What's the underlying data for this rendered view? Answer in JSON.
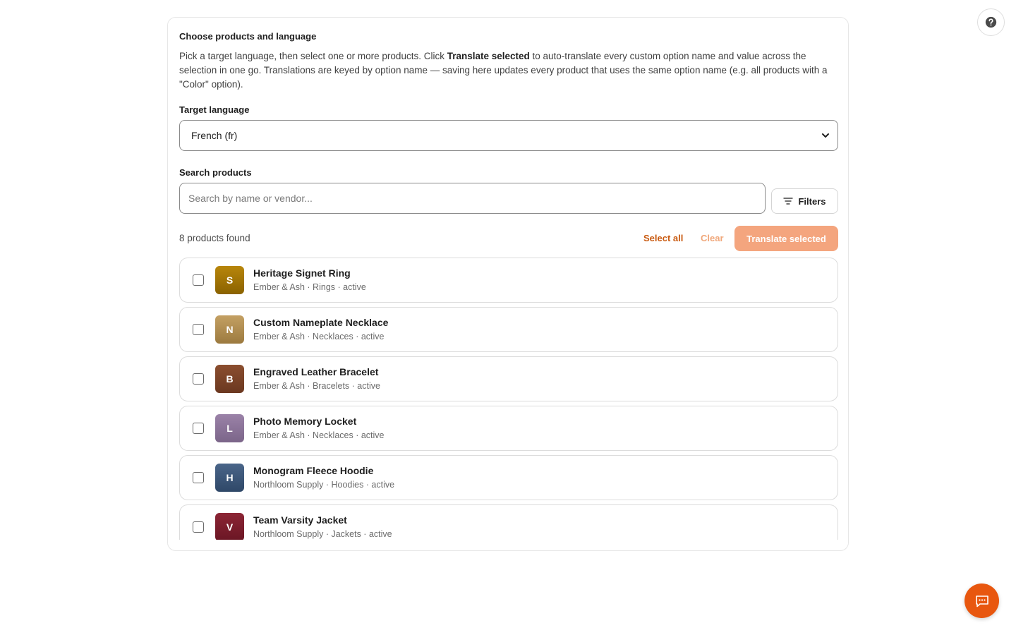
{
  "card": {
    "title": "Choose products and language",
    "description_parts": [
      "Pick a target language, then select one or more products. Click ",
      "Translate selected",
      " to auto-translate every custom option name and value across the selection in one go. Translations are keyed by option name — saving here updates every product that uses the same option name (e.g. all products with a \"Color\" option)."
    ]
  },
  "language": {
    "label": "Target language",
    "selected": "French (fr)"
  },
  "search": {
    "label": "Search products",
    "placeholder": "Search by name or vendor...",
    "value": "",
    "filters_label": "Filters"
  },
  "toolbar": {
    "count_text": "8 products found",
    "select_all_label": "Select all",
    "clear_label": "Clear",
    "translate_label": "Translate selected"
  },
  "colors": {
    "accent": "#e8570f",
    "accent_link": "#c95a10",
    "accent_disabled": "#f4a57e"
  },
  "products": [
    {
      "initial": "S",
      "name": "Heritage Signet Ring",
      "meta": "Ember & Ash · Rings · active",
      "color_top": "#b8860b",
      "color_bottom": "#8a6200"
    },
    {
      "initial": "N",
      "name": "Custom Nameplate Necklace",
      "meta": "Ember & Ash · Necklaces · active",
      "color_top": "#c4a063",
      "color_bottom": "#9c7a3f"
    },
    {
      "initial": "B",
      "name": "Engraved Leather Bracelet",
      "meta": "Ember & Ash · Bracelets · active",
      "color_top": "#8b4e2f",
      "color_bottom": "#6b3820"
    },
    {
      "initial": "L",
      "name": "Photo Memory Locket",
      "meta": "Ember & Ash · Necklaces · active",
      "color_top": "#9b82a8",
      "color_bottom": "#7b6589"
    },
    {
      "initial": "H",
      "name": "Monogram Fleece Hoodie",
      "meta": "Northloom Supply · Hoodies · active",
      "color_top": "#4a6589",
      "color_bottom": "#2f4868"
    },
    {
      "initial": "V",
      "name": "Team Varsity Jacket",
      "meta": "Northloom Supply · Jackets · active",
      "color_top": "#8c2535",
      "color_bottom": "#6a1624"
    }
  ],
  "icons": {
    "help": "question-circle-icon",
    "chat": "chat-bubble-icon",
    "filters": "filter-lines-icon",
    "select": "chevron-down-icon"
  }
}
